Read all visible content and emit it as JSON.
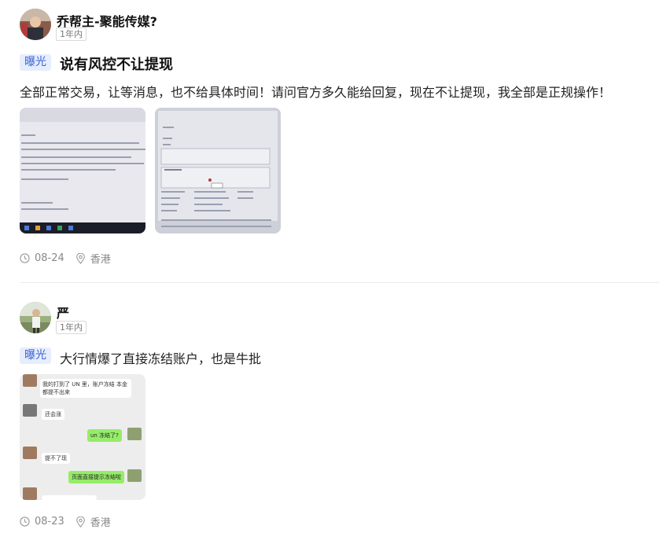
{
  "posts": [
    {
      "user": {
        "name": "乔帮主-聚能传媒?",
        "time_badge": "1年内"
      },
      "tag": "曝光",
      "title": "说有风控不让提现",
      "content": "全部正常交易，让等消息，也不给具体时间！请问官方多久能给回复，现在不让提现，我全部是正规操作！",
      "date": "08-24",
      "location": "香港"
    },
    {
      "user": {
        "name": "严",
        "time_badge": "1年内"
      },
      "tag": "曝光",
      "title": "大行情爆了直接冻结账户，也是牛批",
      "chat": {
        "msg1": "我的打到了 UN 里，账户冻结 本金都提不出来",
        "msg2": "还会涨",
        "msg3": "un 冻结了?",
        "msg4": "提不了现",
        "msg5": "页面直接提示冻结啦"
      },
      "date": "08-23",
      "location": "香港"
    }
  ],
  "icons": {
    "clock": "clock-icon",
    "location": "location-pin-icon"
  }
}
